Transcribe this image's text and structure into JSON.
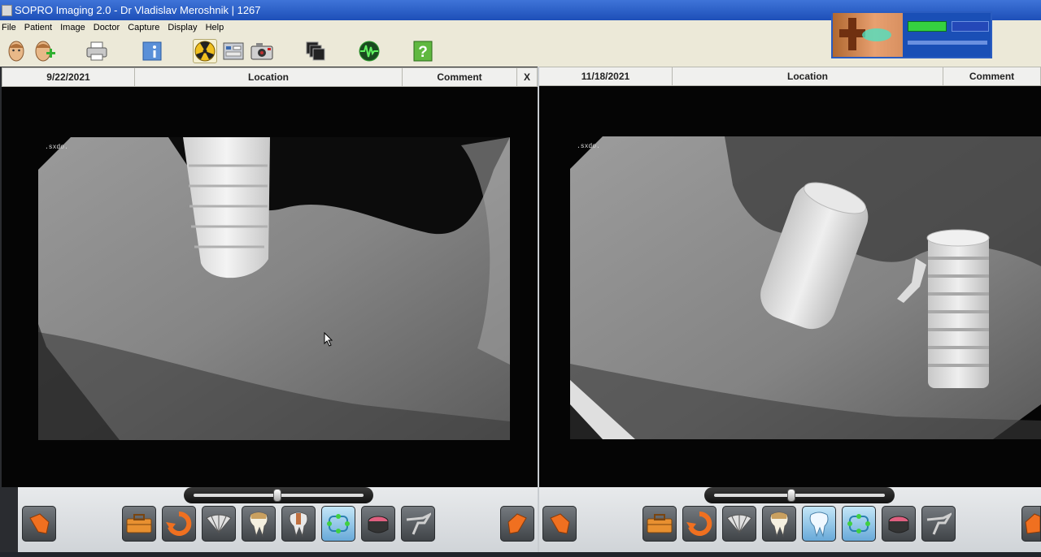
{
  "window": {
    "title": "SOPRO Imaging 2.0 - Dr Vladislav Meroshnik | 1267"
  },
  "menu": [
    "File",
    "Patient",
    "Image",
    "Doctor",
    "Capture",
    "Display",
    "Help"
  ],
  "toolbar_icons": [
    "patient-face-icon",
    "add-patient-icon",
    "printer-icon",
    "info-icon",
    "radiation-icon",
    "adjust-panel-icon",
    "camera-icon",
    "stack-images-icon",
    "waveform-icon",
    "help-icon"
  ],
  "left_panel": {
    "date": "9/22/2021",
    "location": "Location",
    "comment": "Comment",
    "close": "X"
  },
  "right_panel": {
    "date": "11/18/2021",
    "location": "Location",
    "comment": "Comment"
  },
  "colors": {
    "title": "#2856c8",
    "pane": "#050505",
    "footer": "#dfe2e5",
    "accent_orange": "#e87020",
    "accent_cyan": "#58c8e8"
  }
}
